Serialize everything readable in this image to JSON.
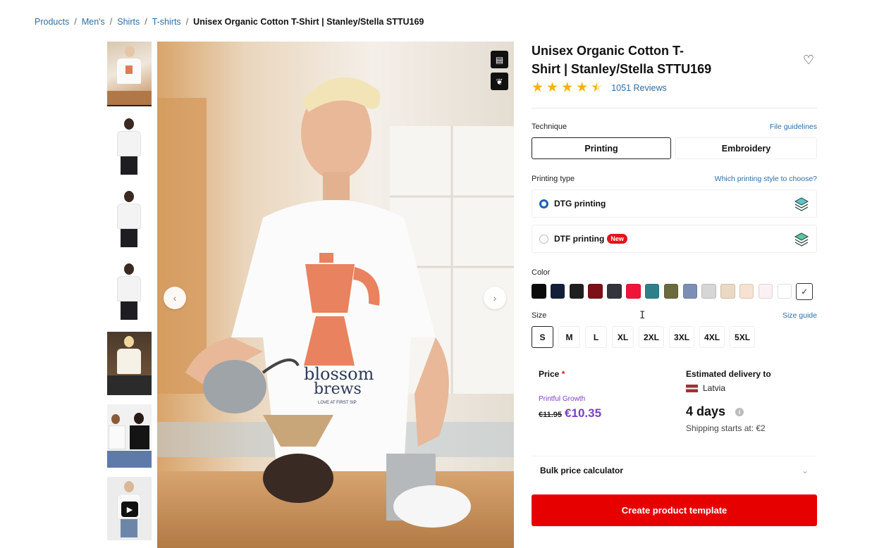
{
  "breadcrumb": {
    "items": [
      "Products",
      "Men's",
      "Shirts",
      "T-shirts"
    ],
    "current": "Unisex Organic Cotton T-Shirt | Stanley/Stella STTU169"
  },
  "product": {
    "title_line1": "Unisex Organic Cotton T-",
    "title_line2": "Shirt | Stanley/Stella STTU169",
    "reviews": "1051 Reviews",
    "rating": 4.5,
    "shirt_print_line1": "blossom",
    "shirt_print_line2": "brews",
    "shirt_print_tagline": "LOVE AT FIRST SIP"
  },
  "technique": {
    "label": "Technique",
    "link": "File guidelines",
    "options": [
      "Printing",
      "Embroidery"
    ],
    "selected": "Printing"
  },
  "printing_type": {
    "label": "Printing type",
    "link": "Which printing style to choose?",
    "options": [
      {
        "label": "DTG printing",
        "selected": true,
        "badge": ""
      },
      {
        "label": "DTF printing",
        "selected": false,
        "badge": "New"
      }
    ]
  },
  "color": {
    "label": "Color",
    "swatches": [
      "#0b0b0b",
      "#14203a",
      "#1f1f1f",
      "#7c1016",
      "#34343c",
      "#f0143a",
      "#2f7f8a",
      "#6a6a3e",
      "#7b8fb5",
      "#d6d6d6",
      "#ead9c3",
      "#f6e2d2",
      "#fbf1f3",
      "#ffffff"
    ],
    "selected_check": "✓"
  },
  "size": {
    "label": "Size",
    "link": "Size guide",
    "options": [
      "S",
      "M",
      "L",
      "XL",
      "2XL",
      "3XL",
      "4XL",
      "5XL"
    ],
    "selected": "S"
  },
  "price": {
    "label": "Price",
    "required_mark": "*",
    "tier": "Printful Growth",
    "old": "€11.95",
    "new": "€10.35"
  },
  "delivery": {
    "label": "Estimated delivery to",
    "country": "Latvia",
    "days": "4 days",
    "shipping": "Shipping starts at: €2"
  },
  "bulk": {
    "label": "Bulk price calculator"
  },
  "cta": {
    "label": "Create product template"
  },
  "icons": {
    "star": "★",
    "heart": "♡",
    "chevron_down": "⌄",
    "prev": "‹",
    "next": "›",
    "play": "▶",
    "info": "i"
  },
  "accent": {
    "link": "#2b6ea8",
    "cta": "#e70000",
    "price": "#7b3fc2"
  }
}
